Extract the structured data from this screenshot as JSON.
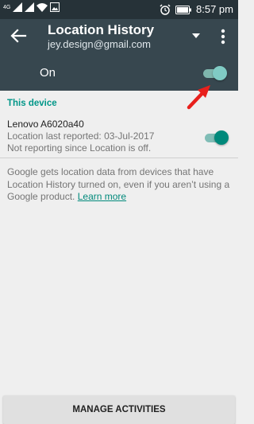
{
  "status_bar": {
    "network_type": "4G",
    "time": "8:57 pm"
  },
  "header": {
    "title": "Location History",
    "account": "jey.design@gmail.com",
    "icons": [
      "arrow-back-icon",
      "dropdown-triangle-icon",
      "more-vert-icon"
    ]
  },
  "master_toggle": {
    "label": "On",
    "state": "on"
  },
  "device_section": {
    "title": "This device",
    "device_name": "Lenovo A6020a40",
    "last_reported": "Location last reported: 03-Jul-2017",
    "reporting_status": "Not reporting since Location is off.",
    "toggle_state": "on"
  },
  "info": {
    "text": "Google gets location data from devices that have Location History turned on, even if you aren’t using a Google product. ",
    "link": "Learn more"
  },
  "footer": {
    "manage_button": "MANAGE ACTIVITIES"
  },
  "colors": {
    "header_bg": "#37474f",
    "status_bar_bg": "#263238",
    "accent": "#009688",
    "annotation_arrow": "#e8201c"
  }
}
